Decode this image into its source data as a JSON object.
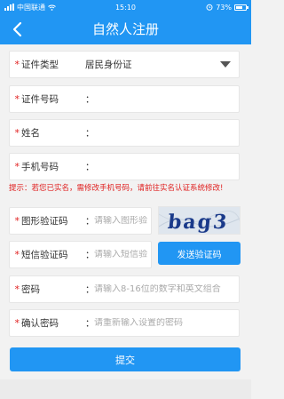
{
  "status_bar": {
    "carrier": "中国联通",
    "time": "15:10",
    "battery": "73%",
    "battery_level": 0.73
  },
  "nav": {
    "title": "自然人注册"
  },
  "form": {
    "required_mark": "*",
    "colon": "：",
    "id_type": {
      "label": "证件类型",
      "value": "居民身份证"
    },
    "id_number": {
      "label": "证件号码",
      "value": ""
    },
    "name": {
      "label": "姓名",
      "value": ""
    },
    "phone": {
      "label": "手机号码",
      "value": ""
    },
    "tip": "提示：若您已实名，需修改手机号码，请前往实名认证系统修改!",
    "captcha": {
      "label": "图形验证码",
      "placeholder": "请输入图形验",
      "image_text": "bag3"
    },
    "sms_code": {
      "label": "短信验证码",
      "placeholder": "请输入短信验",
      "button": "发送验证码"
    },
    "password": {
      "label": "密码",
      "placeholder": "请输入8-16位的数字和英文组合"
    },
    "confirm_password": {
      "label": "确认密码",
      "placeholder": "请重新输入设置的密码"
    },
    "submit": "提交"
  },
  "colors": {
    "primary": "#2196f3",
    "required": "#e02020",
    "background": "#f2f2f2"
  }
}
